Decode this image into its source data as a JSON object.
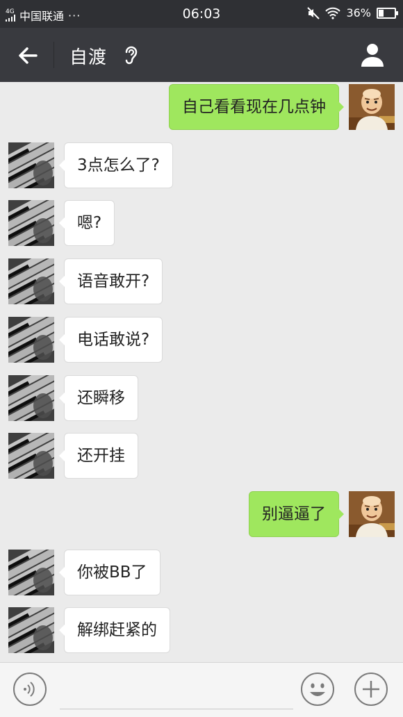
{
  "status_bar": {
    "network": "4G",
    "carrier": "中国联通",
    "more": "···",
    "time": "06:03",
    "battery_text": "36%",
    "battery_level": 0.36
  },
  "header": {
    "title": "自渡",
    "back_icon": "arrow-left-icon",
    "ear_icon": "ear-icon",
    "profile_icon": "person-icon"
  },
  "messages": [
    {
      "side": "out",
      "text": "自己看看现在几点钟"
    },
    {
      "side": "in",
      "text": "3点怎么了?"
    },
    {
      "side": "in",
      "text": "嗯?"
    },
    {
      "side": "in",
      "text": "语音敢开?"
    },
    {
      "side": "in",
      "text": "电话敢说?"
    },
    {
      "side": "in",
      "text": "还瞬移"
    },
    {
      "side": "in",
      "text": "还开挂"
    },
    {
      "side": "out",
      "text": "别逼逼了"
    },
    {
      "side": "in",
      "text": "你被BB了"
    },
    {
      "side": "in",
      "text": "解绑赶紧的"
    }
  ],
  "input_bar": {
    "value": "",
    "voice_icon": "voice-icon",
    "emoji_icon": "emoji-icon",
    "plus_icon": "plus-icon"
  },
  "colors": {
    "status_bg": "#2f3034",
    "header_bg": "#393a3f",
    "chat_bg": "#ebebeb",
    "outgoing_bubble": "#9fe75e",
    "incoming_bubble": "#ffffff"
  }
}
